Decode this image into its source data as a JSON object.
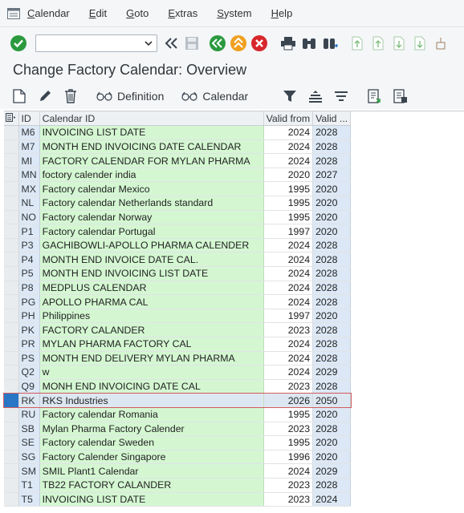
{
  "menu": [
    "Calendar",
    "Edit",
    "Goto",
    "Extras",
    "System",
    "Help"
  ],
  "command_field": {
    "value": "",
    "placeholder": ""
  },
  "title": "Change Factory Calendar: Overview",
  "app_toolbar": {
    "definition_label": "Definition",
    "calendar_label": "Calendar"
  },
  "table": {
    "headers": {
      "id": "ID",
      "calendar_id": "Calendar ID",
      "valid_from": "Valid from",
      "valid_to": "Valid ..."
    },
    "rows": [
      {
        "id": "M6",
        "desc": "INVOICING LIST DATE",
        "from": "2024",
        "to": "2028"
      },
      {
        "id": "M7",
        "desc": "MONTH END INVOICING DATE CALENDAR",
        "from": "2024",
        "to": "2028"
      },
      {
        "id": "MI",
        "desc": "FACTORY CALENDAR FOR MYLAN PHARMA",
        "from": "2024",
        "to": "2028"
      },
      {
        "id": "MN",
        "desc": "foctory calender india",
        "from": "2020",
        "to": "2027"
      },
      {
        "id": "MX",
        "desc": "Factory calendar Mexico",
        "from": "1995",
        "to": "2020"
      },
      {
        "id": "NL",
        "desc": "Factory calendar Netherlands standard",
        "from": "1995",
        "to": "2020"
      },
      {
        "id": "NO",
        "desc": "Factory calendar Norway",
        "from": "1995",
        "to": "2020"
      },
      {
        "id": "P1",
        "desc": "Factory calendar Portugal",
        "from": "1997",
        "to": "2020"
      },
      {
        "id": "P3",
        "desc": "GACHIBOWLI-APOLLO PHARMA CALENDER",
        "from": "2024",
        "to": "2028"
      },
      {
        "id": "P4",
        "desc": "MONTH END INVOICE DATE CAL.",
        "from": "2024",
        "to": "2028"
      },
      {
        "id": "P5",
        "desc": "MONTH END INVOICING LIST DATE",
        "from": "2024",
        "to": "2028"
      },
      {
        "id": "P8",
        "desc": "MEDPLUS CALENDAR",
        "from": "2024",
        "to": "2028"
      },
      {
        "id": "PG",
        "desc": "APOLLO PHARMA CAL",
        "from": "2024",
        "to": "2028"
      },
      {
        "id": "PH",
        "desc": "Philippines",
        "from": "1997",
        "to": "2020"
      },
      {
        "id": "PK",
        "desc": "FACTORY CALANDER",
        "from": "2023",
        "to": "2028"
      },
      {
        "id": "PR",
        "desc": "MYLAN PHARMA FACTORY CAL",
        "from": "2024",
        "to": "2028"
      },
      {
        "id": "PS",
        "desc": "MONTH END DELIVERY MYLAN PHARMA",
        "from": "2024",
        "to": "2028"
      },
      {
        "id": "Q2",
        "desc": "w",
        "from": "2024",
        "to": "2029"
      },
      {
        "id": "Q9",
        "desc": "MONH END INVOICING DATE CAL",
        "from": "2023",
        "to": "2028"
      },
      {
        "id": "RK",
        "desc": "RKS Industries",
        "from": "2026",
        "to": "2050",
        "selected": true
      },
      {
        "id": "RU",
        "desc": "Factory calendar Romania",
        "from": "1995",
        "to": "2020"
      },
      {
        "id": "SB",
        "desc": "Mylan Pharma Factory Calender",
        "from": "2023",
        "to": "2028"
      },
      {
        "id": "SE",
        "desc": "Factory calendar Sweden",
        "from": "1995",
        "to": "2020"
      },
      {
        "id": "SG",
        "desc": "Factory Calender Singapore",
        "from": "1996",
        "to": "2020"
      },
      {
        "id": "SM",
        "desc": "SMIL Plant1 Calendar",
        "from": "2024",
        "to": "2029"
      },
      {
        "id": "T1",
        "desc": "TB22 FACTORY CALANDER",
        "from": "2023",
        "to": "2028"
      },
      {
        "id": "T5",
        "desc": "INVOICING LIST DATE",
        "from": "2023",
        "to": "2024"
      }
    ]
  }
}
